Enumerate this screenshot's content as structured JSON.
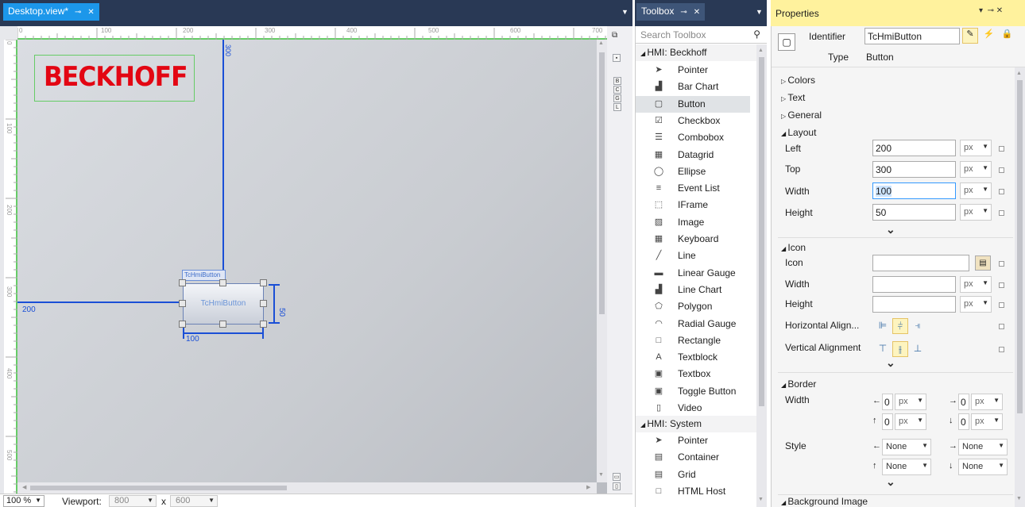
{
  "designer": {
    "tab_title": "Desktop.view*",
    "ruler_h": [
      "0",
      "100",
      "200",
      "300",
      "400",
      "500",
      "600",
      "700"
    ],
    "ruler_v": [
      "0",
      "100",
      "200",
      "300",
      "400",
      "500"
    ],
    "logo_text": "BECKHOFF",
    "button_label": "TcHmiButton",
    "button_tag": "TcHmiButton",
    "dim_top": "300",
    "dim_left": "200",
    "dim_width": "100",
    "dim_height": "50",
    "zoom": "100 %",
    "viewport_label": "Viewport:",
    "viewport_w": "800",
    "viewport_x": "x",
    "viewport_h": "600",
    "side_letters": [
      "B",
      "C",
      "G",
      "L"
    ]
  },
  "toolbox": {
    "tab_title": "Toolbox",
    "search_placeholder": "Search Toolbox",
    "group_beckhoff": "HMI: Beckhoff",
    "items": [
      {
        "label": "Pointer",
        "icon": "pointer-icon",
        "glyph": "➤"
      },
      {
        "label": "Bar Chart",
        "icon": "bar-chart-icon",
        "glyph": "▟"
      },
      {
        "label": "Button",
        "icon": "button-icon",
        "glyph": "▢"
      },
      {
        "label": "Checkbox",
        "icon": "checkbox-icon",
        "glyph": "☑"
      },
      {
        "label": "Combobox",
        "icon": "combobox-icon",
        "glyph": "☰"
      },
      {
        "label": "Datagrid",
        "icon": "datagrid-icon",
        "glyph": "▦"
      },
      {
        "label": "Ellipse",
        "icon": "ellipse-icon",
        "glyph": "◯"
      },
      {
        "label": "Event List",
        "icon": "event-list-icon",
        "glyph": "≡"
      },
      {
        "label": "IFrame",
        "icon": "iframe-icon",
        "glyph": "⬚"
      },
      {
        "label": "Image",
        "icon": "image-icon",
        "glyph": "▨"
      },
      {
        "label": "Keyboard",
        "icon": "keyboard-icon",
        "glyph": "▦"
      },
      {
        "label": "Line",
        "icon": "line-icon",
        "glyph": "╱"
      },
      {
        "label": "Linear Gauge",
        "icon": "linear-gauge-icon",
        "glyph": "▬"
      },
      {
        "label": "Line Chart",
        "icon": "line-chart-icon",
        "glyph": "▟"
      },
      {
        "label": "Polygon",
        "icon": "polygon-icon",
        "glyph": "⬠"
      },
      {
        "label": "Radial Gauge",
        "icon": "radial-gauge-icon",
        "glyph": "◠"
      },
      {
        "label": "Rectangle",
        "icon": "rectangle-icon",
        "glyph": "□"
      },
      {
        "label": "Textblock",
        "icon": "textblock-icon",
        "glyph": "A"
      },
      {
        "label": "Textbox",
        "icon": "textbox-icon",
        "glyph": "▣"
      },
      {
        "label": "Toggle Button",
        "icon": "toggle-button-icon",
        "glyph": "▣"
      },
      {
        "label": "Video",
        "icon": "video-icon",
        "glyph": "▯"
      }
    ],
    "group_system": "HMI: System",
    "system_items": [
      {
        "label": "Pointer",
        "icon": "pointer-icon",
        "glyph": "➤"
      },
      {
        "label": "Container",
        "icon": "container-icon",
        "glyph": "▤"
      },
      {
        "label": "Grid",
        "icon": "grid-icon",
        "glyph": "▤"
      },
      {
        "label": "HTML Host",
        "icon": "html-host-icon",
        "glyph": "□"
      }
    ]
  },
  "properties": {
    "tab_title": "Properties",
    "identifier_label": "Identifier",
    "identifier_value": "TcHmiButton",
    "type_label": "Type",
    "type_value": "Button",
    "colors": "Colors",
    "text": "Text",
    "general": "General",
    "layout": "Layout",
    "left_label": "Left",
    "left_value": "200",
    "top_label": "Top",
    "top_value": "300",
    "width_label": "Width",
    "width_value": "100",
    "height_label": "Height",
    "height_value": "50",
    "unit": "px",
    "icon_section": "Icon",
    "icon_label": "Icon",
    "icon_width_label": "Width",
    "icon_height_label": "Height",
    "halign_label": "Horizontal Align...",
    "valign_label": "Vertical Alignment",
    "border": "Border",
    "border_width_label": "Width",
    "border_w_values": [
      "0",
      "0",
      "0",
      "0"
    ],
    "style_label": "Style",
    "style_values": [
      "None",
      "None",
      "None",
      "None"
    ],
    "background_image": "Background Image"
  }
}
